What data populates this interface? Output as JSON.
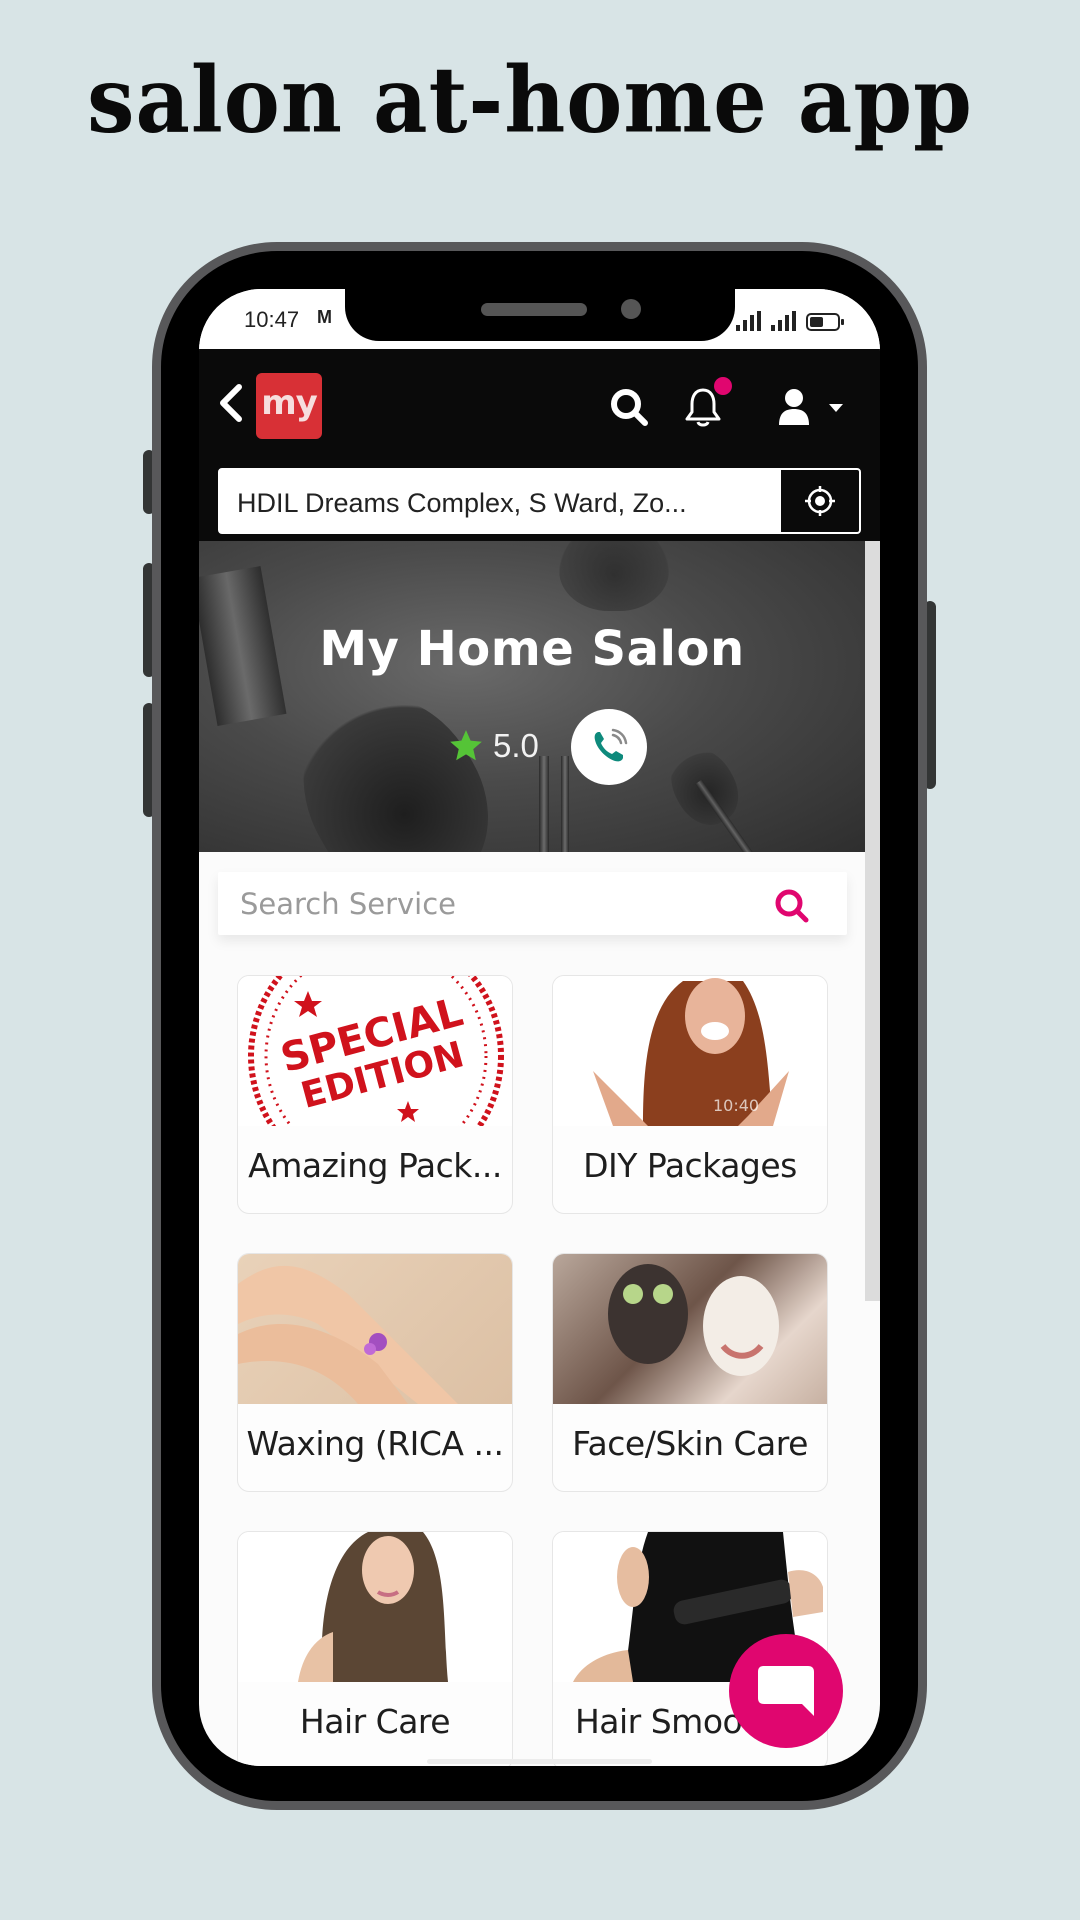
{
  "page": {
    "title": "salon at-home app"
  },
  "status_bar": {
    "time": "10:47",
    "mail_icon": "gmail-icon",
    "signal_icons": [
      "signal-icon",
      "signal-icon"
    ],
    "battery_icon": "battery-icon"
  },
  "header": {
    "back_icon": "chevron-left-icon",
    "logo_text": "my",
    "search_icon": "search-icon",
    "notification_icon": "bell-icon",
    "profile_icon": "user-icon",
    "profile_dropdown_icon": "caret-down-icon",
    "address": "HDIL Dreams Complex, S Ward, Zo...",
    "locate_icon": "crosshair-icon"
  },
  "hero": {
    "title": "My Home Salon",
    "rating": "5.0",
    "rating_icon": "star-icon",
    "call_icon": "phone-call-icon"
  },
  "service_search": {
    "placeholder": "Search Service",
    "value": "",
    "icon": "search-icon"
  },
  "categories": [
    {
      "label": "Amazing Pack...",
      "image": "special-edition-stamp"
    },
    {
      "label": "DIY Packages",
      "image": "smiling-woman"
    },
    {
      "label": "Waxing (RICA ...",
      "image": "legs-with-flower"
    },
    {
      "label": "Face/Skin Care",
      "image": "women-face-masks"
    },
    {
      "label": "Hair Care",
      "image": "woman-long-hair"
    },
    {
      "label": "Hair Smooth...",
      "image": "hair-straightener"
    }
  ],
  "colors": {
    "accent": "#e0066f",
    "logo_red": "#d83036",
    "header_bg": "#0a0a0a",
    "rating_star": "#55c437",
    "call_icon": "#0e8a7c",
    "page_bg": "#d8e4e6"
  },
  "fab": {
    "icon": "chat-bubble-icon"
  }
}
